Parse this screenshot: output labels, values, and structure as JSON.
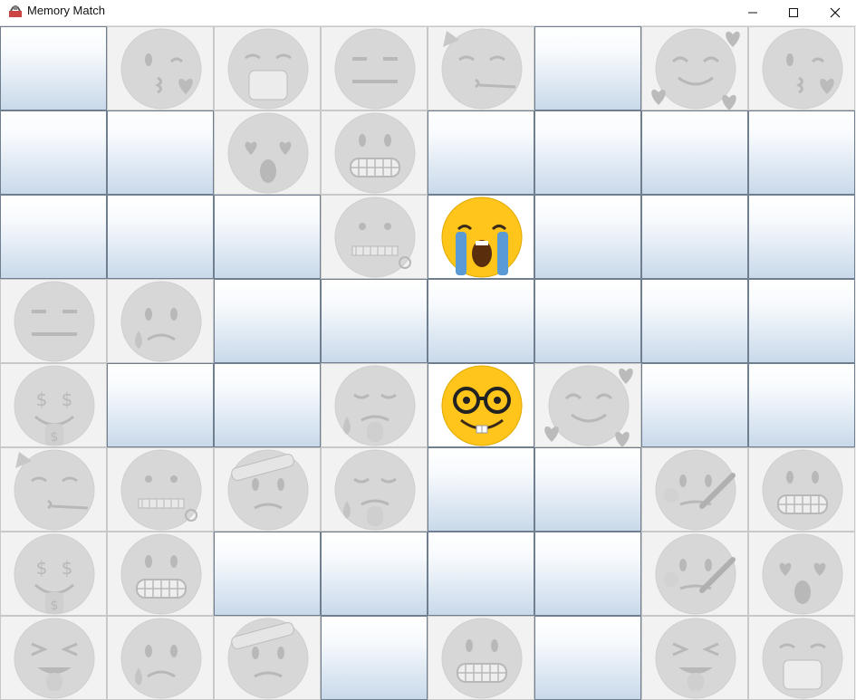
{
  "window": {
    "title": "Memory Match",
    "minimize_icon": "minimize-icon",
    "maximize_icon": "maximize-icon",
    "close_icon": "close-icon"
  },
  "board": {
    "rows": 8,
    "cols": 8,
    "legend": {
      "H": "hidden",
      "F": "flipped",
      "M": "matched"
    },
    "cells": [
      [
        "H",
        "M",
        "M",
        "M",
        "M",
        "H",
        "M",
        "M"
      ],
      [
        "H",
        "H",
        "M",
        "M",
        "H",
        "H",
        "H",
        "H"
      ],
      [
        "H",
        "H",
        "H",
        "M",
        "F",
        "H",
        "H",
        "H"
      ],
      [
        "M",
        "M",
        "H",
        "H",
        "H",
        "H",
        "H",
        "H"
      ],
      [
        "M",
        "H",
        "H",
        "M",
        "F",
        "M",
        "H",
        "H"
      ],
      [
        "M",
        "M",
        "M",
        "M",
        "H",
        "H",
        "M",
        "M"
      ],
      [
        "M",
        "M",
        "H",
        "H",
        "H",
        "H",
        "M",
        "M"
      ],
      [
        "M",
        "M",
        "M",
        "H",
        "M",
        "H",
        "M",
        "M"
      ]
    ],
    "emojis": [
      [
        null,
        "kiss-heart",
        "mask",
        "neutral",
        "party",
        null,
        "smile-hearts",
        "kiss-heart"
      ],
      [
        null,
        null,
        "star-struck-scream",
        "cold-grimace",
        null,
        null,
        null,
        null
      ],
      [
        null,
        null,
        null,
        "zipper",
        "loudly-crying",
        null,
        null,
        null
      ],
      [
        "neutral",
        "sad-tear",
        null,
        null,
        null,
        null,
        null,
        null
      ],
      [
        "money-mouth",
        null,
        null,
        "drooling",
        "nerd",
        "smile-hearts",
        null,
        null
      ],
      [
        "party",
        "zipper",
        "bandage",
        "drooling",
        null,
        null,
        "thermometer",
        "cold-grimace"
      ],
      [
        "money-mouth",
        "grimace",
        null,
        null,
        null,
        null,
        "thermometer",
        "star-struck-scream"
      ],
      [
        "squint-tongue",
        "sad-tear",
        "bandage",
        null,
        "grimace",
        null,
        "squint-tongue",
        "mask"
      ]
    ]
  },
  "colors": {
    "emoji_face": "#ffc51a",
    "emoji_faded": "#d8d8d8",
    "tile_border": "#6f7f8f"
  }
}
